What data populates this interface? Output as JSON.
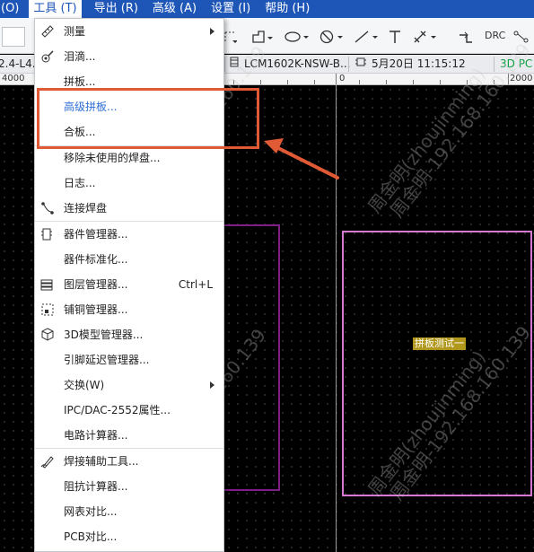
{
  "menubar": {
    "items": [
      {
        "label": "(O)"
      },
      {
        "label": "工具 (T)"
      },
      {
        "label": "导出 (R)"
      },
      {
        "label": "高级 (A)"
      },
      {
        "label": "设置 (I)"
      },
      {
        "label": "帮助 (H)"
      }
    ]
  },
  "toolbar": {
    "drc_label": "DRC"
  },
  "tabs": {
    "left_fragment": "2.4-L4...",
    "component": "LCM1602K-NSW-B...",
    "timestamp": "5月20日 11:15:12",
    "view3d": "3D PC"
  },
  "ruler": {
    "left": "4000",
    "zero": "0",
    "right": "2000"
  },
  "canvas": {
    "board_label": "拼板测试一",
    "watermark_name": "周金明(zhoujinming)",
    "watermark_ip": "周金明-192.168.160.139"
  },
  "menu": {
    "items": [
      {
        "label": "测量",
        "has_submenu": true,
        "icon": "ruler-icon"
      },
      {
        "label": "泪滴...",
        "icon": "teardrop-icon"
      },
      {
        "label": "拼板..."
      },
      {
        "label": "高级拼板...",
        "highlight": true
      },
      {
        "label": "合板..."
      },
      {
        "label": "移除未使用的焊盘..."
      },
      {
        "label": "日志..."
      },
      {
        "label": "连接焊盘",
        "icon": "connect-pads-icon"
      },
      {
        "label": "器件管理器...",
        "icon": "component-manager-icon"
      },
      {
        "label": "器件标准化..."
      },
      {
        "label": "图层管理器...",
        "shortcut": "Ctrl+L",
        "icon": "layer-manager-icon"
      },
      {
        "label": "铺铜管理器...",
        "icon": "copper-pour-icon"
      },
      {
        "label": "3D模型管理器...",
        "icon": "cube-icon"
      },
      {
        "label": "引脚延迟管理器..."
      },
      {
        "label": "交换(W)",
        "has_submenu": true
      },
      {
        "label": "IPC/DAC-2552属性..."
      },
      {
        "label": "电路计算器..."
      },
      {
        "label": "焊接辅助工具...",
        "icon": "solder-tool-icon"
      },
      {
        "label": "阻抗计算器..."
      },
      {
        "label": "网表对比..."
      },
      {
        "label": "PCB对比..."
      }
    ]
  },
  "colors": {
    "menubar_bg": "#1e56b8",
    "highlight_text": "#2f6fd6",
    "callout": "#e05a35",
    "board_a": "#7e1f86",
    "board_b": "#d57ad2"
  }
}
